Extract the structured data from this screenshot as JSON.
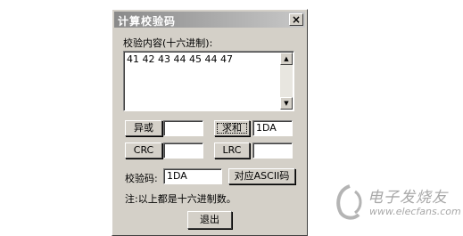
{
  "dialog": {
    "title": "计算校验码",
    "close_label": "×",
    "content_label": "校验内容(十六进制):",
    "content_value": "41 42 43 44 45 44 47",
    "buttons": {
      "xor": "异或",
      "sum": "求和",
      "crc": "CRC",
      "lrc": "LRC",
      "ascii": "对应ASCII码",
      "exit": "退出"
    },
    "fields": {
      "xor_result": "",
      "sum_result": "1DA",
      "crc_result": "",
      "lrc_result": ""
    },
    "checksum_label": "校验码:",
    "checksum_value": "1DA",
    "note": "注:以上都是十六进制数。"
  },
  "watermark": {
    "cn": "电子发烧友",
    "en": "www.elecfans.com"
  }
}
